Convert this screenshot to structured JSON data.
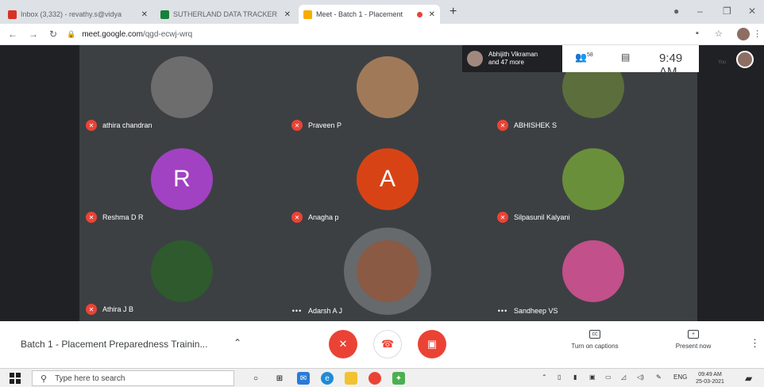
{
  "browser": {
    "tabs": [
      {
        "title": "Inbox (3,332) - revathy.s@vidya",
        "favicon_color": "#d93025"
      },
      {
        "title": "SUTHERLAND DATA TRACKER",
        "favicon_color": "#188038"
      },
      {
        "title": "Meet - Batch 1 - Placement",
        "favicon_color": "#f9ab00"
      }
    ],
    "new_tab": "+",
    "url_host": "meet.google.com",
    "url_path": "/qgd-ecwj-wrq"
  },
  "meet": {
    "top_info": {
      "presenter": "Abhijith Vikraman",
      "presenter_more": "and 47 more",
      "people_count": "58",
      "time": "9:49 AM",
      "you_label": "You"
    },
    "participants": [
      {
        "name": "athira chandran",
        "muted": true,
        "type": "photo",
        "avatar_color": "#6d6d6d"
      },
      {
        "name": "Praveen P",
        "muted": true,
        "type": "photo",
        "avatar_color": "#a07a58"
      },
      {
        "name": "ABHISHEK S",
        "muted": true,
        "type": "photo",
        "avatar_color": "#5c6e3c"
      },
      {
        "name": "Reshma D R",
        "muted": true,
        "type": "letter",
        "letter": "R",
        "avatar_color": "#a142c2"
      },
      {
        "name": "Anagha p",
        "muted": true,
        "type": "letter",
        "letter": "A",
        "avatar_color": "#d84315"
      },
      {
        "name": "Silpasunil Kalyani",
        "muted": true,
        "type": "photo",
        "avatar_color": "#6a8f3a"
      },
      {
        "name": "Athira J B",
        "muted": true,
        "type": "photo",
        "avatar_color": "#2e5a2e"
      },
      {
        "name": "Adarsh A J",
        "muted": false,
        "type": "photo",
        "avatar_color": "#8a5a44"
      },
      {
        "name": "Sandheep VS",
        "muted": false,
        "type": "photo",
        "avatar_color": "#c2508a"
      }
    ],
    "meeting_title": "Batch 1 - Placement Preparedness Trainin...",
    "captions_label": "Turn on captions",
    "present_label": "Present now"
  },
  "taskbar": {
    "search_placeholder": "Type here to search",
    "tray_lang": "ENG",
    "tray_time": "09:49 AM",
    "tray_date": "25-03-2021"
  }
}
